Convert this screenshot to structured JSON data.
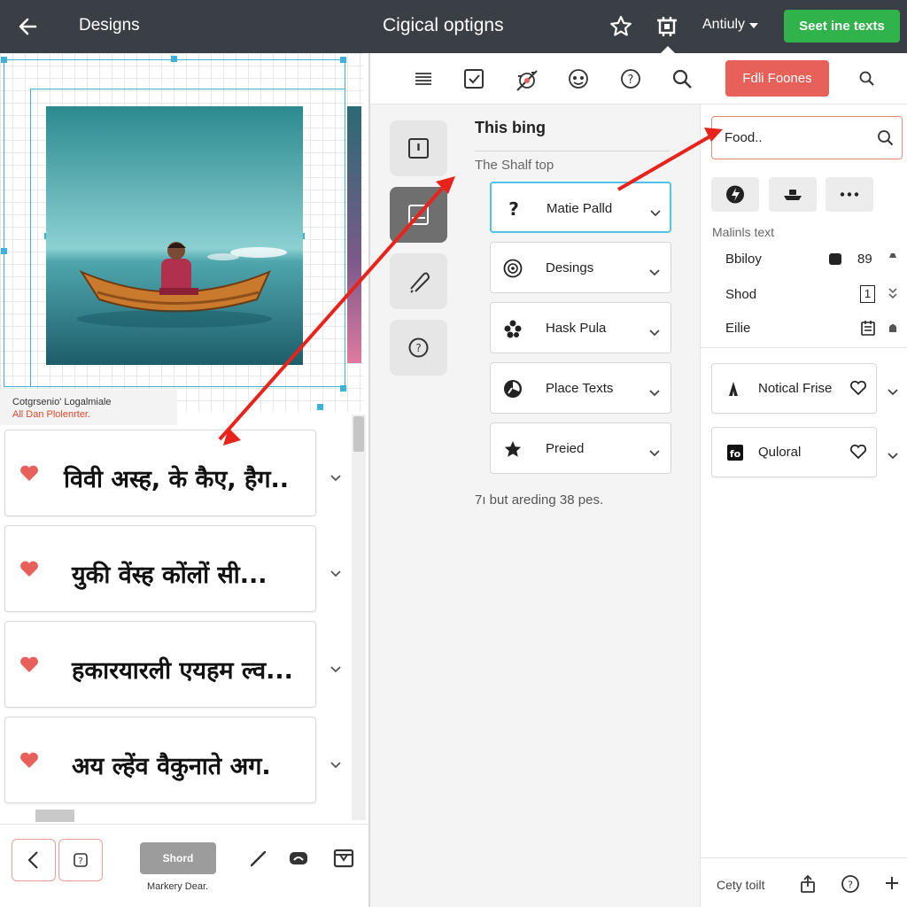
{
  "topbar": {
    "back_icon": "arrow-left-icon",
    "breadcrumb": "Designs",
    "title": "Cigical optigns",
    "account_label": "Antiuly",
    "cta_label": "Seet ine texts",
    "cta_color": "#2fb34a"
  },
  "canvas": {
    "caption_line1": "Cotgrsenio' Logalmiale",
    "caption_line2": "All Dan Plolenrter."
  },
  "left_list": {
    "items": [
      {
        "text": "विवी अस्ह, के कैए, हैग.."
      },
      {
        "text": "युकी वेंस्ह कोंलों सी..."
      },
      {
        "text": "हकारयारली एयहम ल्व..."
      },
      {
        "text": "अय ल्हेंव वैकुनाते अग."
      }
    ],
    "heart_color": "#e8605a"
  },
  "left_bottom": {
    "shord_label": "Shord",
    "markery_label": "Markery Dear."
  },
  "mid_toolbar": {
    "fill_button_label": "Fdli Foones",
    "fill_button_color": "#e8605a"
  },
  "middle": {
    "section_title": "This bing",
    "section_subtitle": "The Shalf top",
    "items": [
      {
        "label": "Matie Palld",
        "icon": "question-icon"
      },
      {
        "label": "Desings",
        "icon": "target-icon"
      },
      {
        "label": "Hask Pula",
        "icon": "flower-icon"
      },
      {
        "label": "Place Texts",
        "icon": "chart-circle-icon"
      },
      {
        "label": "Preied",
        "icon": "star-icon"
      }
    ],
    "footer_text": "7ı but areding 38 pes."
  },
  "right": {
    "search_value": "Food..",
    "section_label": "Malinls text",
    "rows": [
      {
        "label": "Bbiloy",
        "value": "89"
      },
      {
        "label": "Shod",
        "value": "1"
      },
      {
        "label": "Eilie",
        "value": ""
      }
    ],
    "cards": [
      {
        "label": "Notical Frise"
      },
      {
        "label": "Quloral"
      }
    ],
    "bottom_label": "Cety toilt"
  },
  "accent_color": "#3fb0d8",
  "arrow_color": "#e8231b"
}
